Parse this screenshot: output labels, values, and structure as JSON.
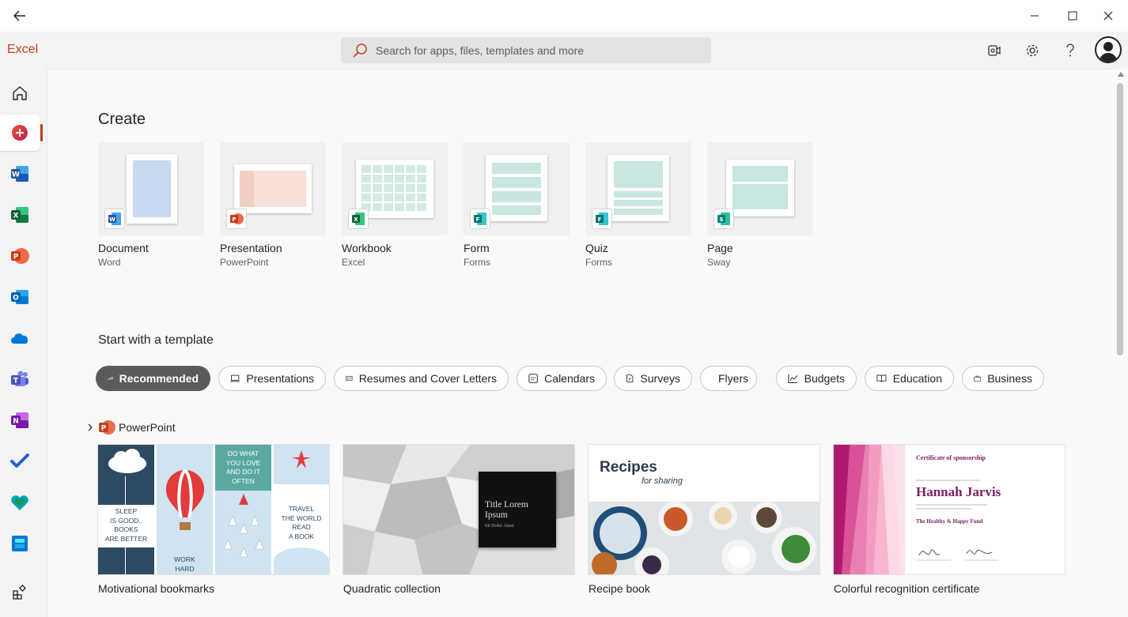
{
  "app": {
    "name": "Excel"
  },
  "search": {
    "placeholder": "Search for apps, files, templates and more"
  },
  "create": {
    "heading": "Create",
    "items": [
      {
        "title": "Document",
        "app": "Word"
      },
      {
        "title": "Presentation",
        "app": "PowerPoint"
      },
      {
        "title": "Workbook",
        "app": "Excel"
      },
      {
        "title": "Form",
        "app": "Forms"
      },
      {
        "title": "Quiz",
        "app": "Forms"
      },
      {
        "title": "Page",
        "app": "Sway"
      }
    ]
  },
  "templates": {
    "heading": "Start with a template",
    "filters": [
      "Recommended",
      "Presentations",
      "Resumes and Cover Letters",
      "Calendars",
      "Surveys",
      "Flyers",
      "Budgets",
      "Education",
      "Business"
    ],
    "selected_filter": "Recommended",
    "group": {
      "name": "PowerPoint"
    },
    "items": [
      {
        "title": "Motivational bookmarks",
        "panels": [
          "SLEEP\nIS GOOD..\nBOOKS\nARE BETTER",
          "WORK\nHARD",
          "DO WHAT\nYOU LOVE\nAND DO IT\nOFTEN",
          "TRAVEL\nTHE WORLD\nREAD\nA BOOK"
        ]
      },
      {
        "title": "Quadratic collection",
        "thumb_title": "Title Lorem Ipsum",
        "thumb_sub": "Sit Dolor Amet"
      },
      {
        "title": "Recipe book",
        "thumb_title": "Recipes",
        "thumb_sub": "for sharing"
      },
      {
        "title": "Colorful recognition certificate",
        "thumb_heading": "Certificate of sponsorship",
        "thumb_name": "Hannah Jarvis",
        "thumb_fund": "The Healthy & Happy Fund"
      }
    ]
  },
  "colors": {
    "accent": "#c43e1c",
    "word": "#2b579a",
    "excel": "#217346",
    "powerpoint": "#d35230",
    "forms": "#077568",
    "sway": "#008272",
    "chip_selected": "#5b5b5b"
  },
  "icons": [
    "back-arrow-icon",
    "minimize-icon",
    "maximize-icon",
    "close-icon",
    "search-icon",
    "meet-now-icon",
    "settings-gear-icon",
    "help-icon",
    "home-icon",
    "create-icon",
    "word-icon",
    "excel-icon",
    "powerpoint-icon",
    "outlook-icon",
    "onedrive-icon",
    "teams-icon",
    "onenote-icon",
    "todo-icon",
    "family-safety-icon",
    "sharepoint-icon",
    "all-apps-icon"
  ]
}
